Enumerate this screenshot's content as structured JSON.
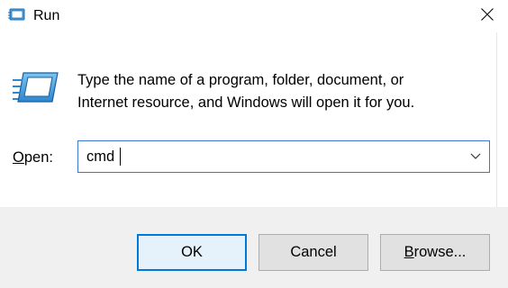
{
  "window": {
    "title": "Run",
    "icon": "run-icon",
    "close_icon": "close-icon"
  },
  "main": {
    "description_line1": "Type the name of a program, folder, document, or",
    "description_line2": "Internet resource, and Windows will open it for you.",
    "open_label_mnemonic": "O",
    "open_label_rest": "pen:",
    "open_value": "cmd"
  },
  "buttons": {
    "ok": "OK",
    "cancel": "Cancel",
    "browse_mnemonic": "B",
    "browse_rest": "rowse..."
  },
  "colors": {
    "focus_border": "#3a78d0",
    "default_button_border": "#0078d7",
    "footer_bg": "#f0f0f0"
  }
}
